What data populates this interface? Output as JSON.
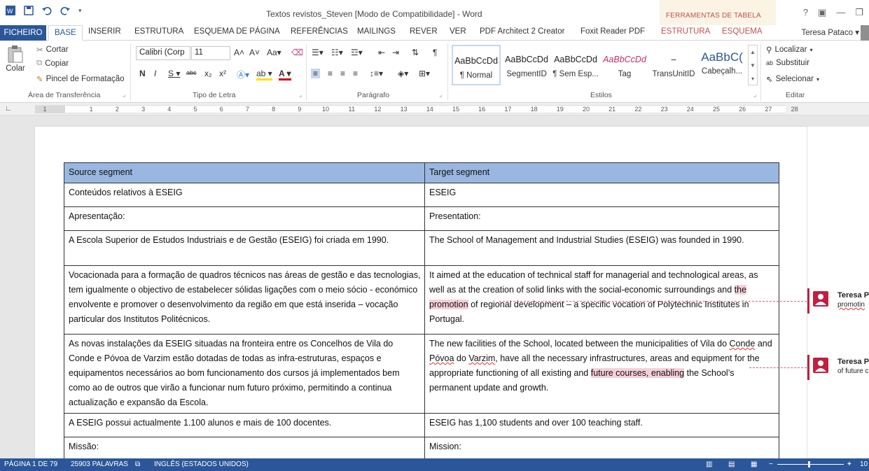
{
  "titlebar": {
    "document_title": "Textos revistos_Steven [Modo de Compatibilidade] - Word",
    "context_tab_group": "FERRAMENTAS DE TABELA",
    "window_controls": [
      "?",
      "▣",
      "—",
      "❐"
    ]
  },
  "tabs": {
    "items": [
      "FICHEIRO",
      "BASE",
      "INSERIR",
      "ESTRUTURA",
      "ESQUEMA DE PÁGINA",
      "REFERÊNCIAS",
      "MAILINGS",
      "REVER",
      "VER",
      "PDF Architect 2 Creator",
      "Foxit Reader PDF",
      "ESTRUTURA",
      "ESQUEMA"
    ],
    "user_name": "Teresa Pataco"
  },
  "ribbon": {
    "clipboard": {
      "paste": "Colar",
      "cut": "Cortar",
      "copy": "Copiar",
      "format_painter": "Pincel de Formatação",
      "label": "Área de Transferência"
    },
    "font": {
      "family": "Calibri (Corp",
      "size": "11",
      "label": "Tipo de Letra"
    },
    "paragraph": {
      "label": "Parágrafo"
    },
    "styles": {
      "items": [
        {
          "preview": "AaBbCcDd",
          "name": "¶ Normal"
        },
        {
          "preview": "AaBbCcDd",
          "name": "SegmentID"
        },
        {
          "preview": "AaBbCcDd",
          "name": "¶ Sem Esp..."
        },
        {
          "preview": "AaBbCcDd",
          "name": "Tag"
        },
        {
          "preview": "–",
          "name": "TransUnitID"
        },
        {
          "preview": "AaBbC(",
          "name": "Cabeçalh..."
        }
      ],
      "label": "Estilos"
    },
    "editing": {
      "find": "Localizar",
      "replace": "Substituir",
      "select": "Selecionar",
      "label": "Editar"
    }
  },
  "ruler": {
    "numbers": [
      "1",
      "1",
      "2",
      "3",
      "4",
      "5",
      "6",
      "7",
      "8",
      "9",
      "10",
      "11",
      "12",
      "13",
      "14",
      "15",
      "16",
      "17",
      "18",
      "19",
      "20",
      "21",
      "22",
      "23",
      "24",
      "25",
      "26",
      "27",
      "28"
    ]
  },
  "table": {
    "header": {
      "source": "Source segment",
      "target": "Target segment"
    },
    "rows": [
      {
        "source": "Conteúdos relativos à ESEIG",
        "target": "ESEIG"
      },
      {
        "source": "Apresentação:",
        "target": "Presentation:"
      },
      {
        "source": "A Escola Superior de Estudos Industriais e de Gestão (ESEIG) foi criada em 1990.",
        "target": "The School of Management and Industrial Studies (ESEIG) was founded in 1990."
      },
      {
        "source": "Vocacionada para a formação de quadros técnicos nas áreas de gestão e das tecnologias, tem igualmente o objectivo de estabelecer sólidas ligações com o meio sócio - económico envolvente e promover o desenvolvimento da região em que está inserida – vocação particular dos Institutos Politécnicos.",
        "target_before": "It aimed at the education of technical staff for managerial and technological areas, as well as at the creation of solid links with the social-economic surroundings and ",
        "target_highlight": "the promotion",
        "target_after": " of regional development – a specific vocation of Polytechnic Institutes in Portugal."
      },
      {
        "source": "As novas instalações da ESEIG situadas na fronteira entre os Concelhos de Vila do Conde e Póvoa de Varzim estão dotadas de todas as infra-estruturas, espaços e equipamentos necessários ao bom funcionamento dos cursos já implementados bem como ao de outros que virão a funcionar num futuro próximo, permitindo a continua actualização e expansão da Escola.",
        "target_p1": "The new facilities of the School, located between the municipalities of Vila do ",
        "target_sq1": "Conde",
        "target_p2": " and ",
        "target_sq2": "Póvoa",
        "target_p3": " do ",
        "target_sq3": "Varzim",
        "target_p4": ", have all the necessary infrastructures, areas and equipment for the appropriate functioning of all existing and ",
        "target_highlight": "future courses, enabling",
        "target_after": " the School’s permanent update and growth."
      },
      {
        "source": "A ESEIG possui actualmente 1.100 alunos e mais de 100 docentes.",
        "target": "ESEIG has 1,100 students and over 100 teaching staff."
      },
      {
        "source": "Missão:",
        "target": "Mission:"
      }
    ]
  },
  "comments": [
    {
      "author": "Teresa Pa",
      "text": "promotin"
    },
    {
      "author": "Teresa Pa",
      "text": "of future c"
    }
  ],
  "statusbar": {
    "page": "PÁGINA 1 DE 79",
    "words": "25903 PALAVRAS",
    "language": "INGLÊS (ESTADOS UNIDOS)",
    "zoom": "10"
  },
  "colors": {
    "word_blue": "#2b579a",
    "table_header": "#9ab7e1",
    "comment_red": "#c02040",
    "highlight_pink": "#f6d0d8"
  }
}
